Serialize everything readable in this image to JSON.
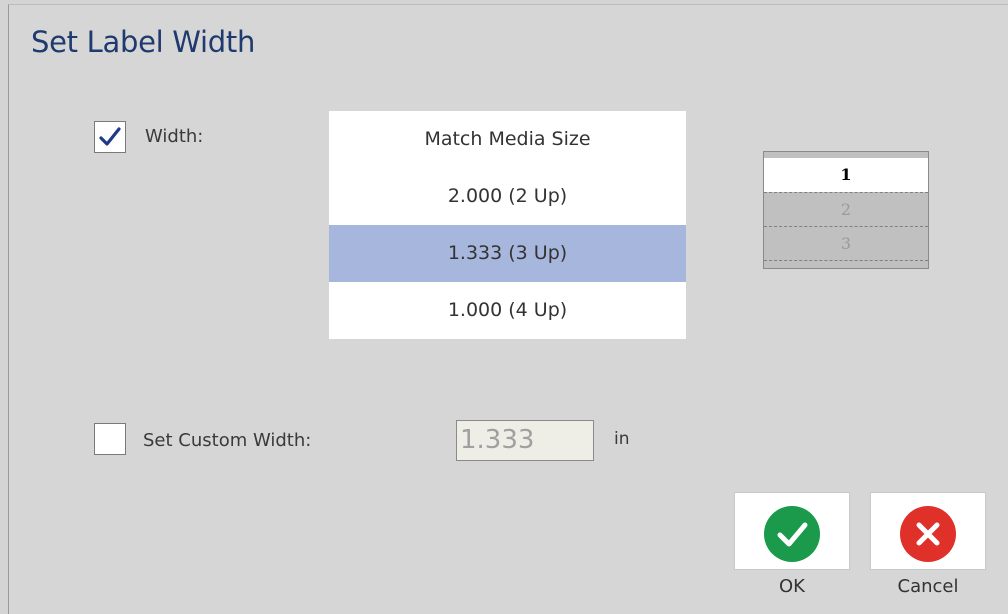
{
  "dialog": {
    "title": "Set Label Width"
  },
  "width_option": {
    "checked": true,
    "label": "Width:"
  },
  "width_list": {
    "items": [
      "Match Media Size",
      "2.000 (2 Up)",
      "1.333 (3 Up)",
      "1.000 (4 Up)"
    ],
    "selected": "1.333 (3 Up)"
  },
  "preview": {
    "rows": [
      "1",
      "2",
      "3"
    ],
    "active_row": "1"
  },
  "custom_width": {
    "checked": false,
    "label": "Set Custom Width:",
    "value": "1.333",
    "unit": "in"
  },
  "buttons": {
    "ok_label": "OK",
    "cancel_label": "Cancel",
    "ok_icon": "checkmark-icon",
    "cancel_icon": "x-icon",
    "ok_color": "#1a9a4a",
    "cancel_color": "#e0302a"
  },
  "colors": {
    "title": "#1f3a6e",
    "selection": "#a7b6dc"
  }
}
